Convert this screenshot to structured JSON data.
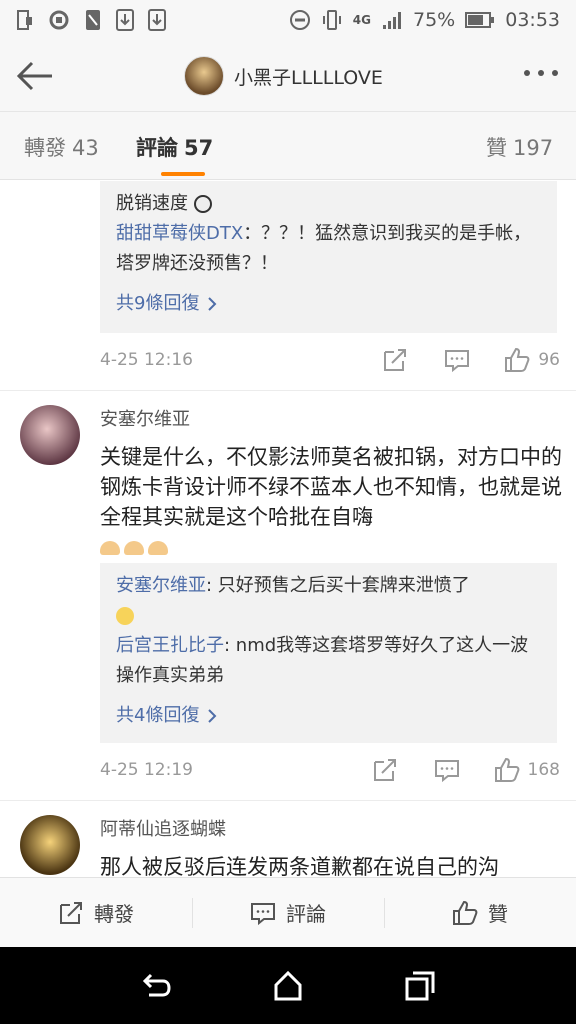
{
  "status_bar": {
    "battery": "75%",
    "time": "03:53",
    "network": "4G"
  },
  "header": {
    "title": "小黑子LLLLLOVE",
    "icons": [
      "back-arrow-icon",
      "more-dots-icon"
    ]
  },
  "tabs": [
    {
      "label": "轉發",
      "count": "43"
    },
    {
      "label": "評論",
      "count": "57"
    },
    {
      "label": "贊",
      "count": "197"
    }
  ],
  "comments": [
    {
      "partial_top_text": "脱销速度",
      "replies": [
        {
          "author": "甜甜草莓侠DTX",
          "text": "：？？！猛然意识到我买的是手帐，塔罗牌还没预售？！"
        }
      ],
      "more_replies": "共9條回復",
      "time": "4-25 12:16",
      "likes": "96"
    },
    {
      "username": "安塞尔维亚",
      "text": "关键是什么，不仅影法师莫名被扣锅，对方口中的钢炼卡背设计师不绿不蓝本人也不知情，也就是说全程其实就是这个哈批在自嗨",
      "replies": [
        {
          "author": "安塞尔维亚",
          "text": ": 只好预售之后买十套牌来泄愤了"
        },
        {
          "author": "后宫王扎比子",
          "text": ": nmd我等这套塔罗等好久了这人一波操作真实弟弟"
        }
      ],
      "more_replies": "共4條回復",
      "time": "4-25 12:19",
      "likes": "168"
    },
    {
      "username": "阿蒂仙追逐蝴蝶",
      "text": "那人被反驳后连发两条道歉都在说自己的沟"
    }
  ],
  "bottom_bar": {
    "repost": "轉發",
    "comment": "評論",
    "like": "贊"
  },
  "colors": {
    "accent": "#ff8200",
    "link": "#4e6da8",
    "reply_bg": "#f2f2f2"
  }
}
